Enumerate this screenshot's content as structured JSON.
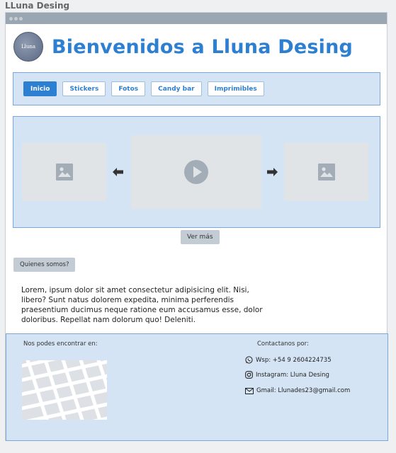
{
  "app": {
    "title": "LLuna Desing"
  },
  "header": {
    "logo_text": "Lluna",
    "title": "Bienvenidos a Lluna Desing"
  },
  "nav": {
    "items": [
      {
        "label": "Inicio",
        "active": true
      },
      {
        "label": "Stickers",
        "active": false
      },
      {
        "label": "Fotos",
        "active": false
      },
      {
        "label": "Candy bar",
        "active": false
      },
      {
        "label": "Imprimibles",
        "active": false
      }
    ]
  },
  "carousel": {
    "slides": [
      "image-icon",
      "play-icon",
      "image-icon"
    ],
    "more_label": "Ver más"
  },
  "about": {
    "button_label": "Quienes somos?",
    "text": "Lorem, ipsum dolor sit amet consectetur adipisicing elit. Nisi, libero? Sunt natus dolorem expedita, minima perferendis praesentium ducimus neque ratione eum accusamus esse, dolor doloribus. Repellat nam dolorum quo! Deleniti."
  },
  "footer": {
    "find_us_label": "Nos podes encontrar en:",
    "contact_label": "Contactanos por:",
    "contacts": [
      {
        "icon": "whatsapp-icon",
        "text": "Wsp: +54 9 2604224735"
      },
      {
        "icon": "instagram-icon",
        "text": "Instagram: Lluna Desing"
      },
      {
        "icon": "mail-icon",
        "text": "Gmail: Llunades23@gmail.com"
      }
    ]
  },
  "colors": {
    "accent": "#2d7fd1",
    "panel": "#d5e4f5",
    "panel_border": "#7aa8dc",
    "button_gray": "#c3ccd5"
  }
}
